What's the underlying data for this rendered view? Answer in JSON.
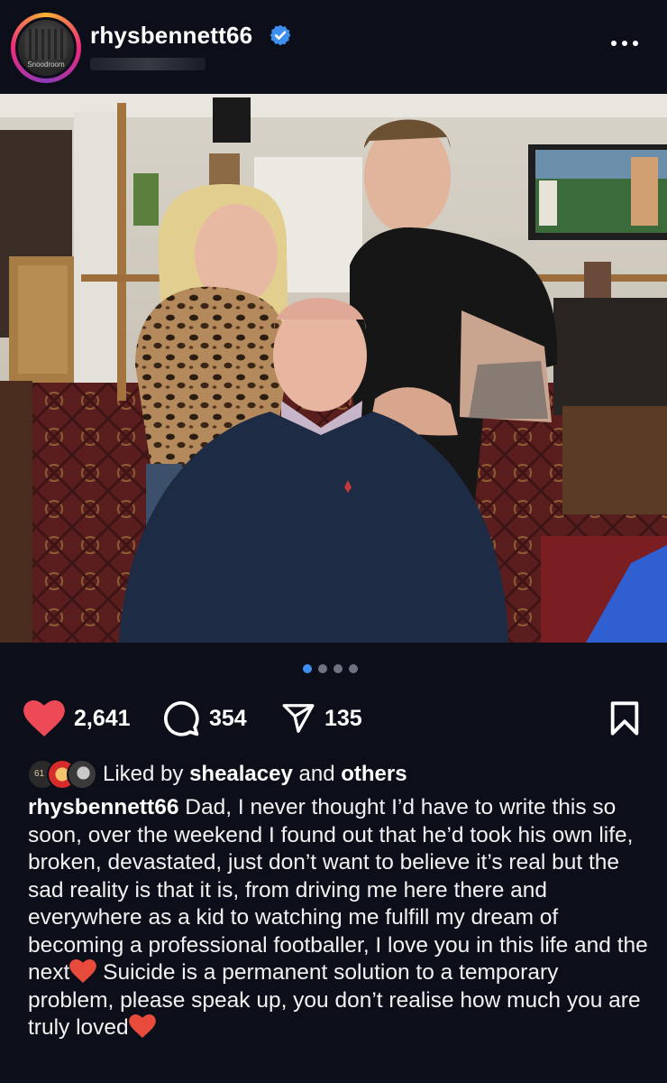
{
  "post": {
    "username": "rhysbennett66",
    "avatar_text": "Snoodroom",
    "verified_icon": "verified-badge-icon",
    "more_icon": "more-options-icon"
  },
  "carousel": {
    "total": 4,
    "active_index": 0
  },
  "actions": {
    "likes": "2,641",
    "comments": "354",
    "shares": "135",
    "like_color": "#ed4956",
    "save_icon": "bookmark-icon"
  },
  "liked_by": {
    "prefix": "Liked by",
    "user": "shealacey",
    "connector": "and",
    "suffix": "others",
    "avatar_badge": "61"
  },
  "caption": {
    "username": "rhysbennett66",
    "part1": "Dad, I never thought I’d have to write this so soon, over the weekend I found out that he’d took his own life, broken, devastated, just don’t want to believe it’s real but the sad reality is that it is, from driving me here there and everywhere as a kid to watching me fulfill my dream of becoming a professional footballer, I love you in this life and the next",
    "part2": " Suicide is a permanent solution to a temporary problem, please speak up, you don’t realise how much you are truly loved"
  },
  "colors": {
    "background": "#0c0f1a",
    "accent_blue": "#3d8ff0",
    "heart_red": "#ed4956"
  }
}
